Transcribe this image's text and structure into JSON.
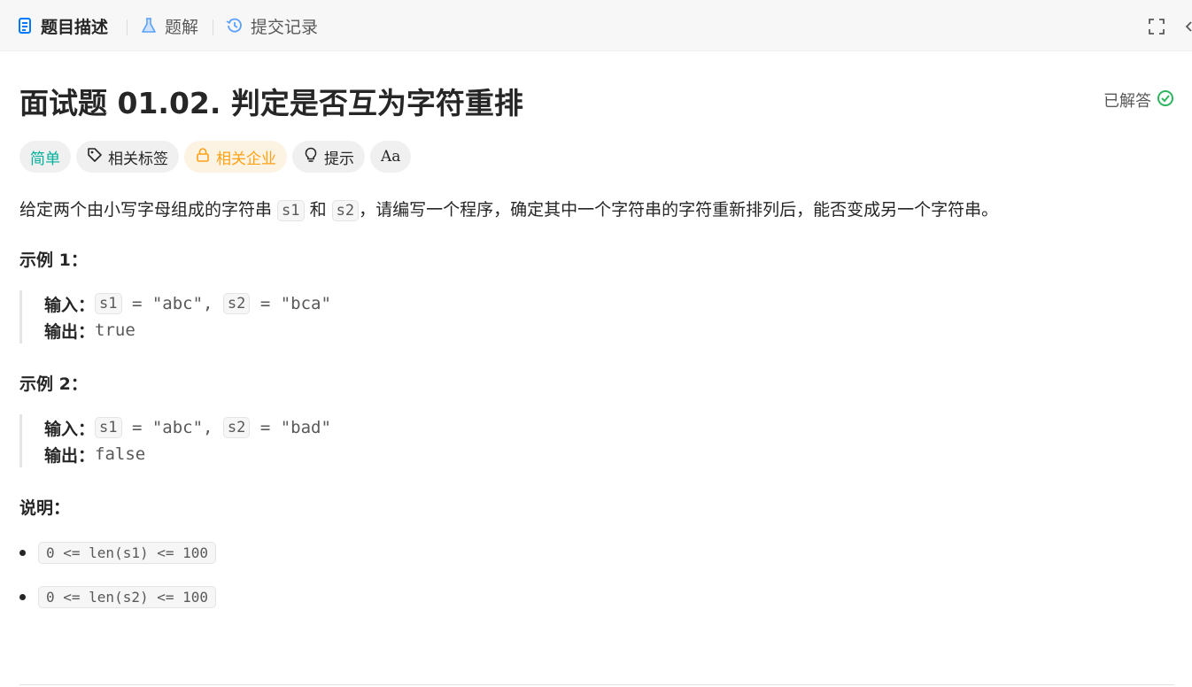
{
  "tabs": [
    {
      "label": "题目描述",
      "icon": "document-icon",
      "active": true
    },
    {
      "label": "题解",
      "icon": "flask-icon",
      "active": false
    },
    {
      "label": "提交记录",
      "icon": "history-icon",
      "active": false
    }
  ],
  "problem": {
    "title": "面试题 01.02. 判定是否互为字符重排",
    "status": "已解答",
    "status_color": "#2db55d"
  },
  "tags": {
    "difficulty": "简单",
    "related_tags": "相关标签",
    "related_companies": "相关企业",
    "hint": "提示",
    "translate_icon": "Aa"
  },
  "description": {
    "part1": "给定两个由小写字母组成的字符串 ",
    "code1": "s1",
    "part2": " 和 ",
    "code2": "s2",
    "part3": "，请编写一个程序，确定其中一个字符串的字符重新排列后，能否变成另一个字符串。"
  },
  "examples": [
    {
      "heading": "示例 1：",
      "input_label": "输入：",
      "var1": "s1",
      "val1": " = \"abc\", ",
      "var2": "s2",
      "val2": " = \"bca\"",
      "output_label": "输出：",
      "output": "true"
    },
    {
      "heading": "示例 2：",
      "input_label": "输入：",
      "var1": "s1",
      "val1": " = \"abc\", ",
      "var2": "s2",
      "val2": " = \"bad\"",
      "output_label": "输出：",
      "output": "false"
    }
  ],
  "notes": {
    "heading": "说明：",
    "items": [
      "0 <= len(s1) <= 100",
      "0 <= len(s2) <= 100"
    ]
  },
  "colors": {
    "accent_blue": "#007aff",
    "easy": "#00af9b",
    "company": "#ffa116"
  }
}
